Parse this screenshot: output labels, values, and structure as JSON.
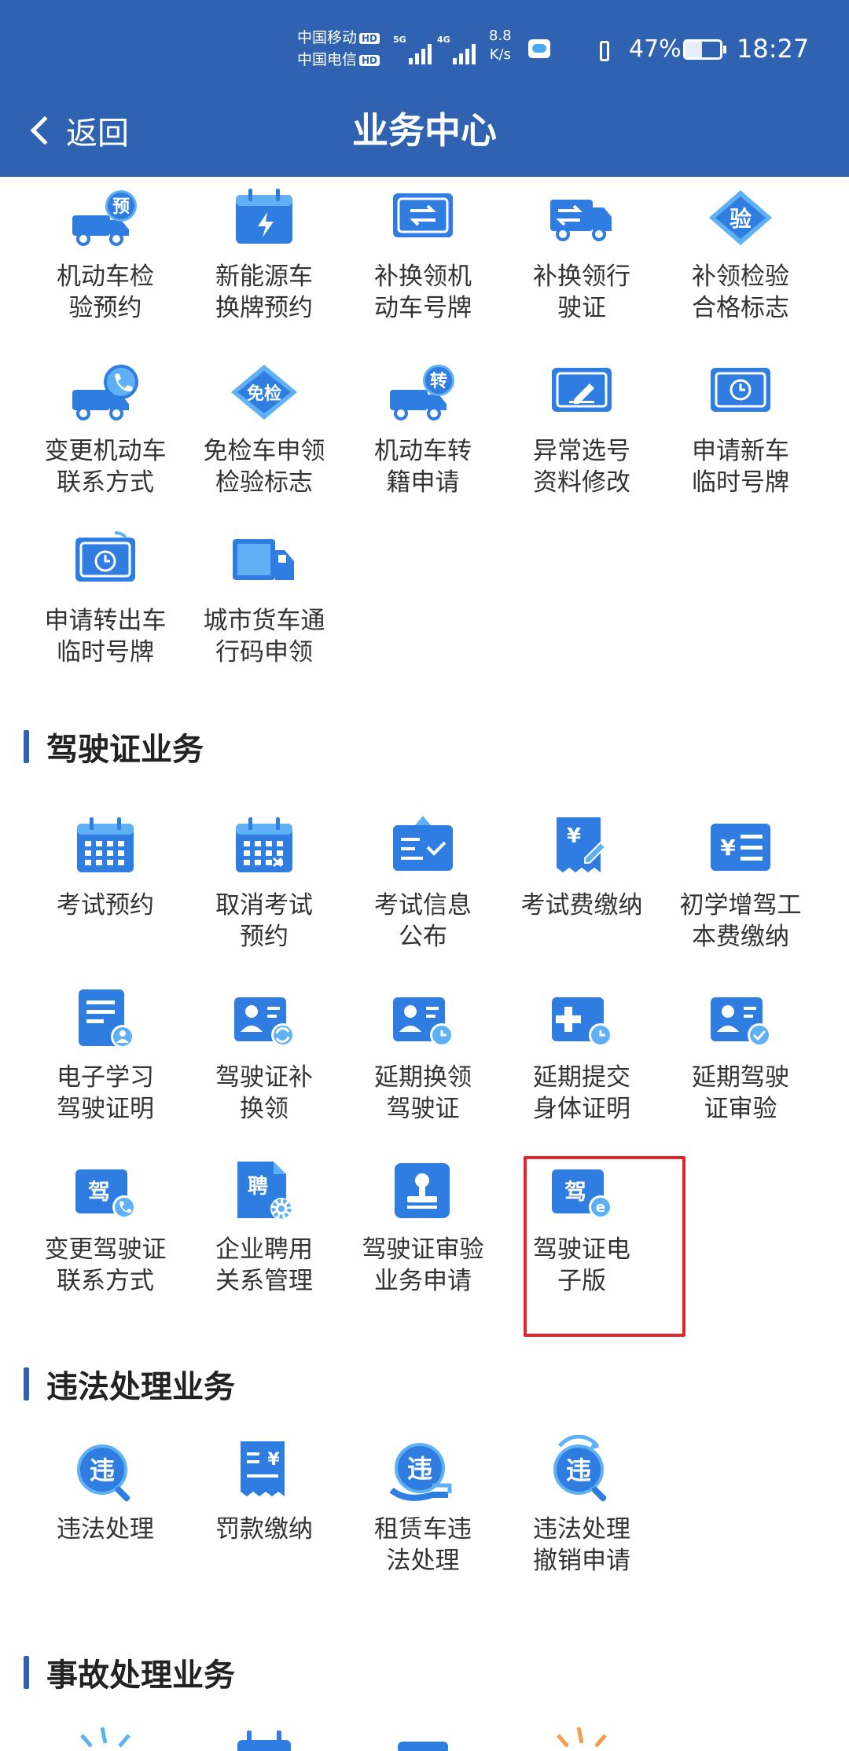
{
  "status_bar": {
    "carrier1": "中国移动",
    "carrier2": "中国电信",
    "hd_badge": "HD",
    "net1": "5G",
    "net2": "4G",
    "speed_value": "8.8",
    "speed_unit": "K/s",
    "battery": "47%",
    "time": "18:27"
  },
  "nav": {
    "back_label": "返回",
    "title": "业务中心"
  },
  "vehicle_section": {
    "items": [
      {
        "label": "机动车检\n验预约",
        "icon": "truck-booking-icon"
      },
      {
        "label": "新能源车\n换牌预约",
        "icon": "calendar-bolt-icon"
      },
      {
        "label": "补换领机\n动车号牌",
        "icon": "plate-swap-icon"
      },
      {
        "label": "补换领行\n驶证",
        "icon": "license-swap-icon"
      },
      {
        "label": "补领检验\n合格标志",
        "icon": "inspection-diamond-icon"
      },
      {
        "label": "变更机动车\n联系方式",
        "icon": "truck-phone-icon"
      },
      {
        "label": "免检车申领\n检验标志",
        "icon": "exempt-diamond-icon"
      },
      {
        "label": "机动车转\n籍申请",
        "icon": "truck-transfer-icon"
      },
      {
        "label": "异常选号\n资料修改",
        "icon": "edit-card-icon"
      },
      {
        "label": "申请新车\n临时号牌",
        "icon": "temp-plate-clock-icon"
      },
      {
        "label": "申请转出车\n临时号牌",
        "icon": "temp-plate-out-icon"
      },
      {
        "label": "城市货车通\n行码申领",
        "icon": "freight-truck-icon"
      }
    ]
  },
  "license_section": {
    "title": "驾驶证业务",
    "items": [
      {
        "label": "考试预约",
        "icon": "exam-calendar-icon"
      },
      {
        "label": "取消考试\n预约",
        "icon": "cancel-calendar-icon"
      },
      {
        "label": "考试信息\n公布",
        "icon": "notice-board-icon"
      },
      {
        "label": "考试费缴纳",
        "icon": "fee-receipt-icon"
      },
      {
        "label": "初学增驾工\n本费缴纳",
        "icon": "yuan-list-icon"
      },
      {
        "label": "电子学习\n驾驶证明",
        "icon": "study-document-icon"
      },
      {
        "label": "驾驶证补\n换领",
        "icon": "license-renew-icon"
      },
      {
        "label": "延期换领\n驾驶证",
        "icon": "license-delay-icon"
      },
      {
        "label": "延期提交\n身体证明",
        "icon": "medical-delay-icon"
      },
      {
        "label": "延期驾驶\n证审验",
        "icon": "license-verify-icon"
      },
      {
        "label": "变更驾驶证\n联系方式",
        "icon": "license-phone-icon"
      },
      {
        "label": "企业聘用\n关系管理",
        "icon": "employment-gear-icon"
      },
      {
        "label": "驾驶证审验\n业务申请",
        "icon": "stamp-icon"
      },
      {
        "label": "驾驶证电\n子版",
        "icon": "e-license-icon"
      }
    ]
  },
  "violation_section": {
    "title": "违法处理业务",
    "items": [
      {
        "label": "违法处理",
        "icon": "violation-search-icon"
      },
      {
        "label": "罚款缴纳",
        "icon": "fine-receipt-icon"
      },
      {
        "label": "租赁车违\n法处理",
        "icon": "rental-violation-icon"
      },
      {
        "label": "违法处理\n撤销申请",
        "icon": "violation-revoke-icon"
      }
    ]
  },
  "accident_section": {
    "title": "事故处理业务"
  },
  "icon_chars": {
    "yu": "预",
    "yan": "验",
    "mianjian": "免检",
    "zhuan": "转",
    "jia": "驾",
    "pin": "聘",
    "wei": "违",
    "yuan": "¥",
    "e": "e"
  },
  "colors": {
    "header_bg": "#2f62b0",
    "icon_blue": "#2f7de0",
    "icon_light": "#5fb0f5",
    "highlight_border": "#e0262b",
    "accent_orange": "#f39c50"
  }
}
